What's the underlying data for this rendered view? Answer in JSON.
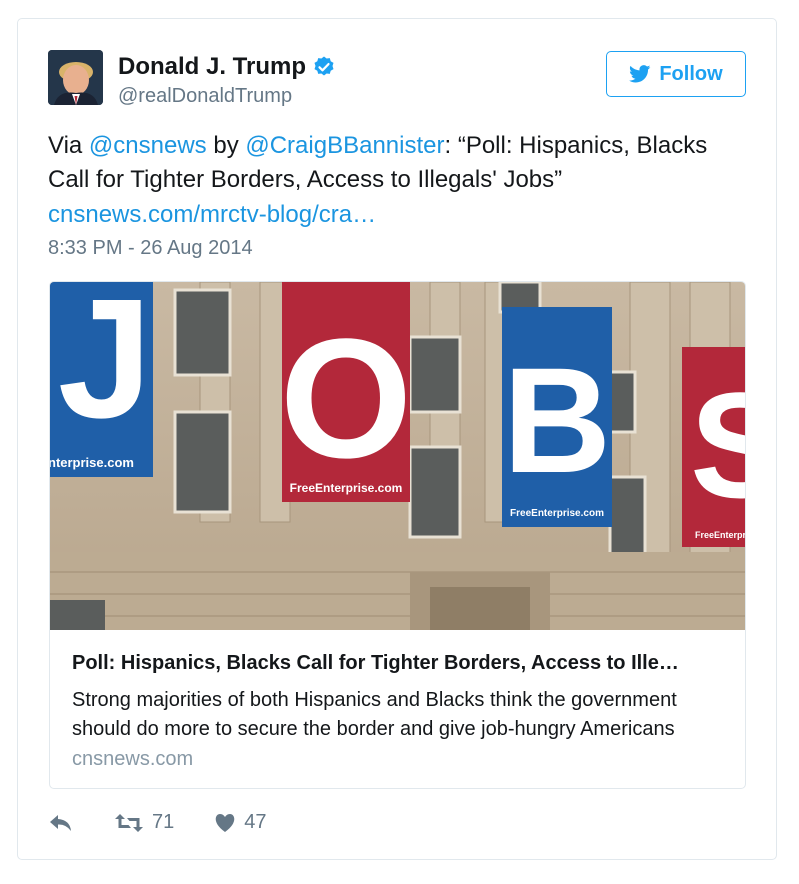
{
  "author": {
    "name": "Donald J. Trump",
    "handle": "@realDonaldTrump",
    "verified": true
  },
  "follow_button": {
    "label": "Follow",
    "icon": "twitter-bird-icon"
  },
  "tweet": {
    "prefix": "Via ",
    "mention1": "@cnsnews",
    "middle": " by ",
    "mention2": "@CraigBBannister",
    "body": ": “Poll: Hispanics, Blacks Call for Tighter Borders, Access to Illegals' Jobs”",
    "link": "cnsnews.com/mrctv-blog/cra…",
    "timestamp": "8:33 PM - 26 Aug 2014"
  },
  "link_card": {
    "banner_letters": [
      "J",
      "O",
      "B",
      "S"
    ],
    "banner_caption": "FreeEnterprise.com",
    "banner_caption_partial": "nterprise.com",
    "title": "Poll: Hispanics, Blacks Call for Tighter Borders, Access to Ille…",
    "description": "Strong majorities of both Hispanics and Blacks think the government should do more to secure the border and give job-hungry Americans",
    "domain": "cnsnews.com"
  },
  "actions": {
    "reply": {
      "icon": "reply-icon"
    },
    "retweet": {
      "icon": "retweet-icon",
      "count": "71"
    },
    "like": {
      "icon": "heart-icon",
      "count": "47"
    }
  },
  "colors": {
    "accent": "#1da1f2",
    "link": "#1b95e0",
    "muted": "#657786",
    "banner_blue": "#1f5fa8",
    "banner_red": "#b3283a"
  }
}
